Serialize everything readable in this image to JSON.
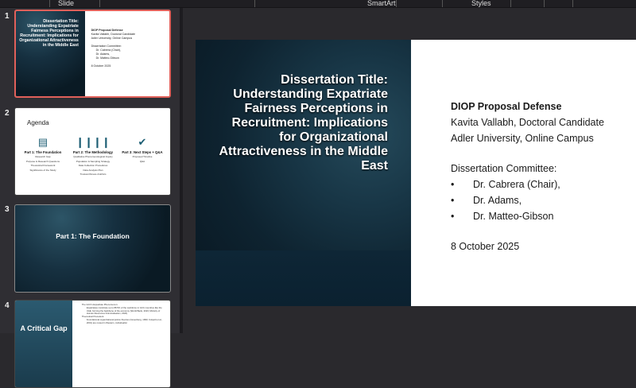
{
  "ribbon": {
    "slide_label": "Slide",
    "smartart_label": "SmartArt",
    "styles_label": "Styles"
  },
  "thumbnails": [
    {
      "number": "1",
      "title": "Dissertation Title: Understanding Expatriate Fairness Perceptions in Recruitment: Implications for Organizational Attractiveness in the Middle East",
      "lines": [
        "DIOP Proposal Defense",
        "Kavita Vallabh, Doctoral Candidate",
        "Adler University, Online Campus",
        "Dissertation Committee:",
        "Dr. Cabrera (Chair),",
        "Dr. Adams,",
        "Dr. Matteo-Gibson",
        "8 October 2025"
      ]
    },
    {
      "number": "2",
      "title": "Agenda",
      "columns": [
        {
          "heading": "Part 1: The Foundation",
          "icon": "books-icon",
          "items": [
            "Research Gap",
            "Purpose & Research Questions",
            "Theoretical Framework",
            "Significance of the Study"
          ]
        },
        {
          "heading": "Part 2: The Methodology",
          "icon": "people-icon",
          "items": [
            "Qualitative Phenomenological Inquiry",
            "Population & Sampling Strategy",
            "Data Collection Procedures",
            "Data Analysis Plan",
            "Trustworthiness & Ethics"
          ]
        },
        {
          "heading": "Part 3: Next Steps + Q&A",
          "icon": "checkmark-icon",
          "items": [
            "Proposed Timeline",
            "Q&A"
          ]
        }
      ]
    },
    {
      "number": "3",
      "title": "Part 1: The Foundation"
    },
    {
      "number": "4",
      "title": "A Critical Gap",
      "bullets": [
        "The GCC's Expatriate Phenomenon:",
        "Expatriates constitute up to 88.5% of the workforce in GCC countries like the UAE, forming the backbone of the economy (World Bank, 2023; Ministry of Human Resources & Emiratisation, 2024)",
        "Theoretical Precedent:",
        "Foundational organizational justice theories (Greenberg, 1990; Colquitt et al., 2001) are rooted in Western, individualist"
      ]
    }
  ],
  "slide": {
    "title": "Dissertation Title: Understanding Expatriate Fairness Perceptions in Recruitment: Implications for Organizational Attractiveness in the Middle East",
    "heading": "DIOP Proposal Defense",
    "presenter": "Kavita Vallabh, Doctoral Candidate",
    "institution": "Adler University, Online Campus",
    "committee_label": "Dissertation Committee:",
    "committee": [
      "Dr. Cabrera (Chair),",
      "Dr. Adams,",
      "Dr. Matteo-Gibson"
    ],
    "date": "8 October 2025"
  }
}
